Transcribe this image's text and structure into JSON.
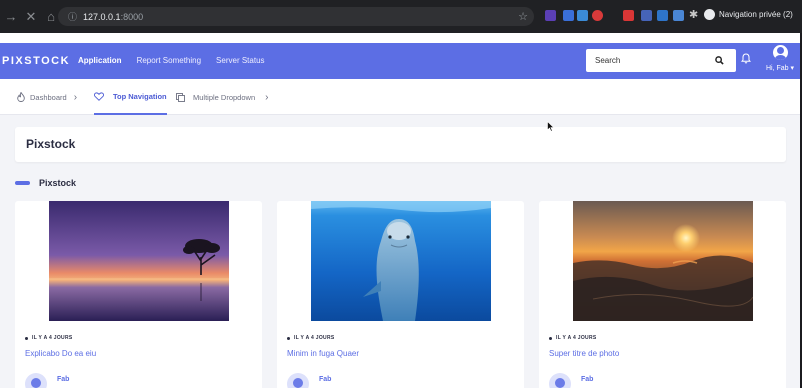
{
  "browser": {
    "url_host": "127.0.0.1",
    "url_port": ":8000",
    "profile_label": "Navigation privée (2)",
    "theme_color": "#202124"
  },
  "header": {
    "brand": "PIXSTOCK",
    "menu": [
      {
        "label": "Application",
        "active": true
      },
      {
        "label": "Report Something",
        "active": false
      },
      {
        "label": "Server Status",
        "active": false
      }
    ],
    "search_placeholder": "Search",
    "user_name": "Hi, Fab",
    "accent_color": "#5c6ee4"
  },
  "subnav": {
    "items": [
      {
        "label": "Dashboard",
        "icon": "fire-icon",
        "active": false
      },
      {
        "label": "Top Navigation",
        "icon": "heart-icon",
        "active": true
      },
      {
        "label": "Multiple Dropdown",
        "icon": "copy-icon",
        "active": false
      }
    ]
  },
  "page": {
    "title": "Pixstock",
    "section_title": "Pixstock"
  },
  "cards": [
    {
      "time": "IL Y A 4 JOURS",
      "title": "Explicabo Do ea eiu",
      "author": "Fab",
      "image": "sunset-tree-photo"
    },
    {
      "time": "IL Y A 4 JOURS",
      "title": "Minim in fuga Quaer",
      "author": "Fab",
      "image": "dolphin-photo"
    },
    {
      "time": "IL Y A 4 JOURS",
      "title": "Super titre de photo",
      "author": "Fab",
      "image": "sunset-sea-photo"
    }
  ]
}
